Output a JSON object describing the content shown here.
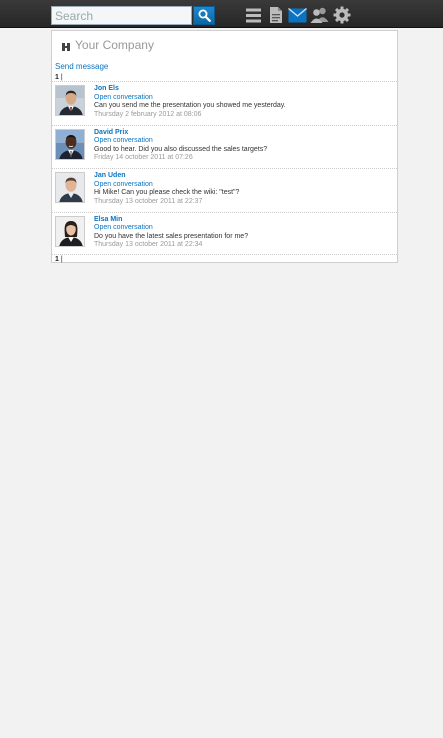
{
  "header": {
    "search_placeholder": "Search",
    "icons": [
      "list-icon",
      "document-icon",
      "mail-icon",
      "people-icon",
      "gear-icon"
    ],
    "accent_color": "#0b74c2",
    "active_icon": "mail-icon"
  },
  "panel": {
    "company_name": "Your Company",
    "send_message": "Send message",
    "pager_top": "1",
    "pager_bottom": "1",
    "messages": [
      {
        "name": "Jon Els",
        "link": "Open conversation",
        "text": "Can you send me the presentation you showed me yesterday.",
        "date": "Thursday 2 february 2012 at 08:06"
      },
      {
        "name": "David Prix",
        "link": "Open conversation",
        "text": "Good to hear. Did you also discussed the sales targets?",
        "date": "Friday 14 october 2011 at 07:26"
      },
      {
        "name": "Jan Uden",
        "link": "Open conversation",
        "text": "Hi Mike! Can you please check the wiki: \"test\"?",
        "date": "Thursday 13 october 2011 at 22:37"
      },
      {
        "name": "Elsa Min",
        "link": "Open conversation",
        "text": "Do you have the latest sales presentation for me?",
        "date": "Thursday 13 october 2011 at 22:34"
      }
    ]
  }
}
